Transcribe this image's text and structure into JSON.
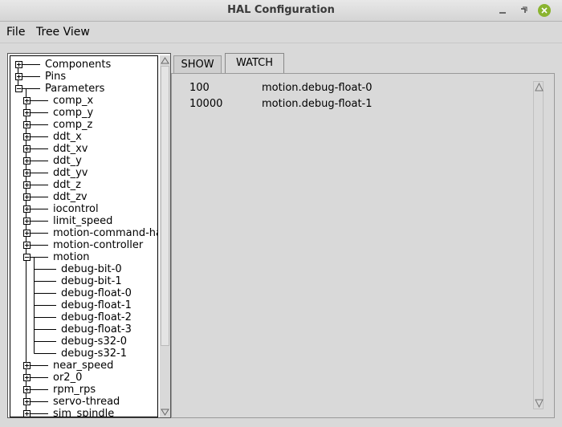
{
  "window": {
    "title": "HAL Configuration"
  },
  "menu": {
    "file": "File",
    "tree_view": "Tree View"
  },
  "tree": {
    "items": [
      {
        "label": "Components",
        "level": 0,
        "expander": "plus"
      },
      {
        "label": "Pins",
        "level": 0,
        "expander": "plus"
      },
      {
        "label": "Parameters",
        "level": 0,
        "expander": "minus"
      },
      {
        "label": "comp_x",
        "level": 1,
        "expander": "plus"
      },
      {
        "label": "comp_y",
        "level": 1,
        "expander": "plus"
      },
      {
        "label": "comp_z",
        "level": 1,
        "expander": "plus"
      },
      {
        "label": "ddt_x",
        "level": 1,
        "expander": "plus"
      },
      {
        "label": "ddt_xv",
        "level": 1,
        "expander": "plus"
      },
      {
        "label": "ddt_y",
        "level": 1,
        "expander": "plus"
      },
      {
        "label": "ddt_yv",
        "level": 1,
        "expander": "plus"
      },
      {
        "label": "ddt_z",
        "level": 1,
        "expander": "plus"
      },
      {
        "label": "ddt_zv",
        "level": 1,
        "expander": "plus"
      },
      {
        "label": "iocontrol",
        "level": 1,
        "expander": "plus"
      },
      {
        "label": "limit_speed",
        "level": 1,
        "expander": "plus"
      },
      {
        "label": "motion-command-handler",
        "level": 1,
        "expander": "plus"
      },
      {
        "label": "motion-controller",
        "level": 1,
        "expander": "plus"
      },
      {
        "label": "motion",
        "level": 1,
        "expander": "minus"
      },
      {
        "label": "debug-bit-0",
        "level": 2,
        "expander": "none"
      },
      {
        "label": "debug-bit-1",
        "level": 2,
        "expander": "none"
      },
      {
        "label": "debug-float-0",
        "level": 2,
        "expander": "none"
      },
      {
        "label": "debug-float-1",
        "level": 2,
        "expander": "none"
      },
      {
        "label": "debug-float-2",
        "level": 2,
        "expander": "none"
      },
      {
        "label": "debug-float-3",
        "level": 2,
        "expander": "none"
      },
      {
        "label": "debug-s32-0",
        "level": 2,
        "expander": "none"
      },
      {
        "label": "debug-s32-1",
        "level": 2,
        "expander": "none"
      },
      {
        "label": "near_speed",
        "level": 1,
        "expander": "plus"
      },
      {
        "label": "or2_0",
        "level": 1,
        "expander": "plus"
      },
      {
        "label": "rpm_rps",
        "level": 1,
        "expander": "plus"
      },
      {
        "label": "servo-thread",
        "level": 1,
        "expander": "plus"
      },
      {
        "label": "sim_spindle",
        "level": 1,
        "expander": "plus"
      }
    ],
    "scroll_fraction_visible": 0.82
  },
  "tabs": {
    "show": "SHOW",
    "watch": "WATCH",
    "active": "watch"
  },
  "watch": {
    "rows": [
      {
        "value": "100",
        "name": "motion.debug-float-0"
      },
      {
        "value": "10000",
        "name": "motion.debug-float-1"
      }
    ]
  },
  "icons": {
    "minimize": "minimize-icon",
    "maximize": "maximize-icon",
    "close": "close-icon",
    "expand": "plus-box-icon",
    "collapse": "minus-box-icon",
    "scroll_up": "triangle-up-icon",
    "scroll_down": "triangle-down-icon"
  },
  "colors": {
    "close_button": "#8ab42f",
    "background": "#d9d9d9"
  }
}
